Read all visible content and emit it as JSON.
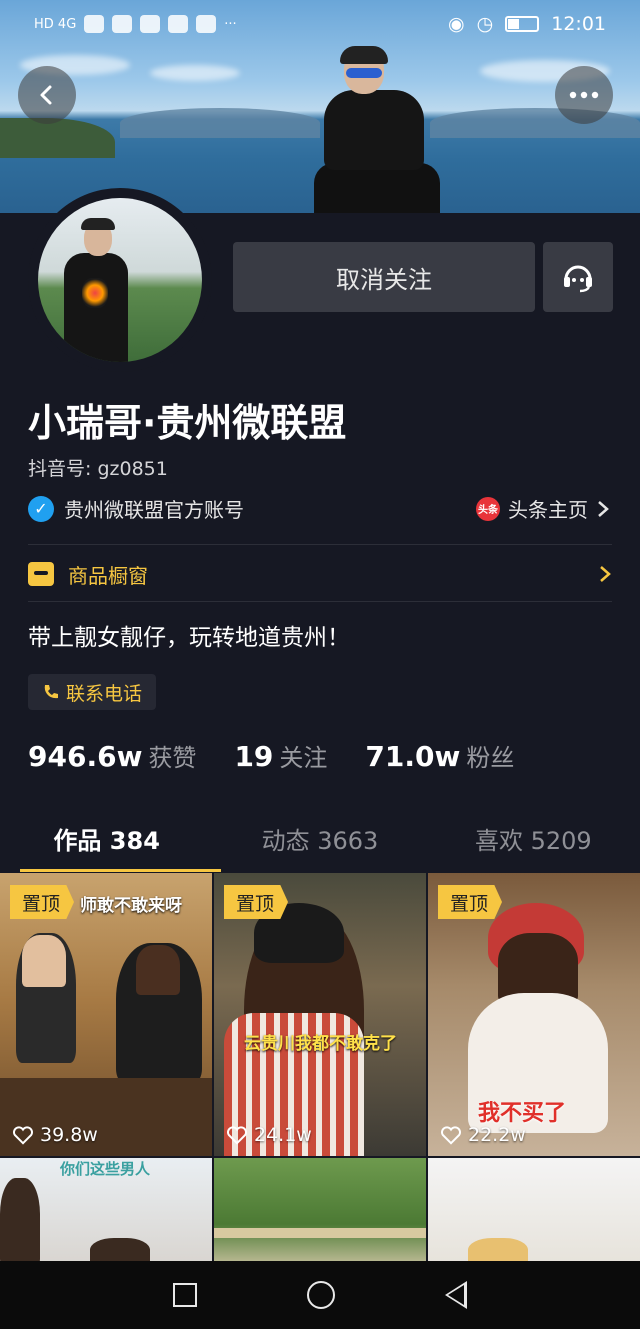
{
  "status_bar": {
    "network": "HD 4G",
    "time": "12:01"
  },
  "header": {
    "back_icon": "chevron-left-icon",
    "more_icon": "more-dots-icon"
  },
  "profile": {
    "unfollow_label": "取消关注",
    "message_icon": "headset-icon",
    "name": "小瑞哥·贵州微联盟",
    "douyin_id": "抖音号: gz0851",
    "verified_text": "贵州微联盟官方账号",
    "toutiao_badge": "头条",
    "toutiao_link": "头条主页",
    "shop_label": "商品橱窗",
    "bio": "带上靓女靓仔，玩转地道贵州！",
    "phone_label": "联系电话"
  },
  "stats": [
    {
      "num": "946.6w",
      "label": "获赞"
    },
    {
      "num": "19",
      "label": "关注"
    },
    {
      "num": "71.0w",
      "label": "粉丝"
    }
  ],
  "tabs": [
    {
      "label": "作品 384",
      "active": true
    },
    {
      "label": "动态 3663",
      "active": false
    },
    {
      "label": "喜欢 5209",
      "active": false
    }
  ],
  "videos": [
    {
      "pinned": "置顶",
      "likes": "39.8w",
      "caption": "师敢不敢来呀"
    },
    {
      "pinned": "置顶",
      "likes": "24.1w",
      "caption": "云贵川我都不敢克了"
    },
    {
      "pinned": "置顶",
      "likes": "22.2w",
      "caption": "我不买了"
    },
    {
      "caption": "你们这些男人"
    },
    {},
    {}
  ],
  "colors": {
    "background": "#161823",
    "accent_yellow": "#f6c641",
    "button_gray": "#393b44",
    "verified_blue": "#20a0f0",
    "toutiao_red": "#e8343a"
  }
}
